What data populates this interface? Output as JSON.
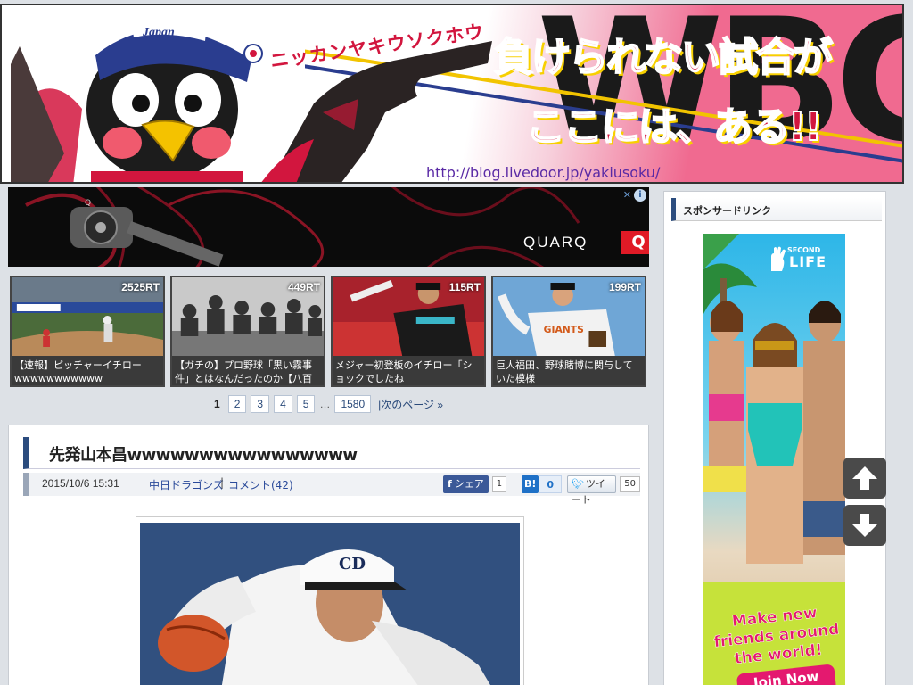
{
  "header": {
    "kana_text": "ニッカンヤキウソクホウ",
    "slogan_line1": "負けられない試合が",
    "slogan_line2": "ここには、ある!!",
    "background_letters": "WBC",
    "url": "http://blog.livedoor.jp/yakiusoku/",
    "cap_text": "Japan"
  },
  "ad_top": {
    "brand": "QUARQ",
    "brand_badge": "Q",
    "adchoices_label": "i",
    "close_label": "✕"
  },
  "thumbnails": [
    {
      "rt": "2525RT",
      "caption": "【速報】ピッチャーイチロー wwwwwwwwwww",
      "scene": "baseball-field"
    },
    {
      "rt": "449RT",
      "caption": "【ガチの】プロ野球「黒い霧事件」とはなんだったのか【八百",
      "scene": "press-conference"
    },
    {
      "rt": "115RT",
      "caption": "メジャー初登板のイチロー「ショックでしたね",
      "scene": "miami-pitcher"
    },
    {
      "rt": "199RT",
      "caption": "巨人福田、野球賭博に関与していた模様",
      "scene": "giants-pitcher"
    }
  ],
  "pager": {
    "current": "1",
    "pages": [
      "2",
      "3",
      "4",
      "5"
    ],
    "ellipsis": "…",
    "last": "1580",
    "next": "|次のページ »"
  },
  "article": {
    "title": "先発山本昌wwwwwwwwwwwwwwww",
    "date": "2015/10/6 15:31",
    "category": "中日ドラゴンズ",
    "separator": "|",
    "comments": "コメント(42)",
    "share_label": "シェア",
    "share_count": "1",
    "hatena_label": "B!",
    "hatena_count": "0",
    "tweet_label": "ツイート",
    "tweet_count": "50"
  },
  "sidebar": {
    "heading": "スポンサードリンク",
    "ad": {
      "logo_small": "SECOND",
      "logo_big": "LIFE",
      "cta": "Make new friends around the world!",
      "join": "Join Now"
    }
  },
  "colors": {
    "accent_navy": "#2b4c7e",
    "link_blue": "#2a4a9a",
    "header_red": "#d2163e",
    "header_pink": "#f06a90"
  },
  "icons": {
    "scroll_up": "arrow-up-icon",
    "scroll_down": "arrow-down-icon"
  }
}
